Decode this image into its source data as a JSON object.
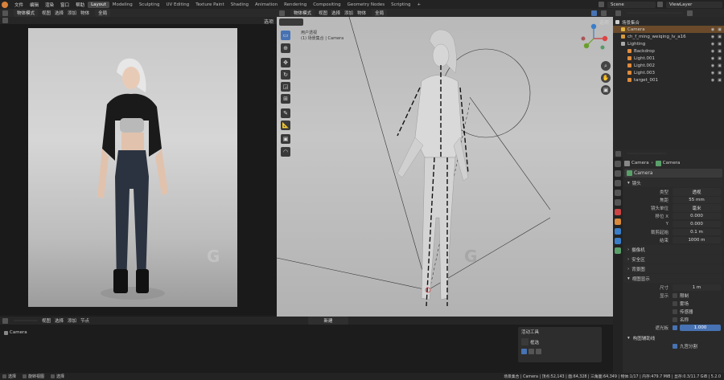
{
  "topbar": {
    "menus": [
      "文件",
      "编辑",
      "渲染",
      "窗口",
      "帮助"
    ],
    "tabs": [
      "Layout",
      "Modeling",
      "Sculpting",
      "UV Editing",
      "Texture Paint",
      "Shading",
      "Animation",
      "Rendering",
      "Compositing",
      "Geometry Nodes",
      "Scripting"
    ],
    "active_tab": "Layout",
    "scene_label": "Scene",
    "view_layer_label": "ViewLayer"
  },
  "left_viewport": {
    "mode": "物体模式",
    "menu": [
      "视图",
      "选择",
      "添加",
      "物体"
    ],
    "shading": "全局",
    "option": "选项"
  },
  "main_viewport": {
    "mode": "物体模式",
    "menu": [
      "视图",
      "选择",
      "添加",
      "物体"
    ],
    "shading": "全局",
    "option": "选项",
    "overlay_line1": "用户透视",
    "overlay_line2": "(1) 场景集合 | Camera"
  },
  "watermarks": [
    "G",
    "G",
    "G"
  ],
  "outliner": {
    "title": "场景集合",
    "items": [
      {
        "label": "Camera",
        "color": "#e0b240",
        "indent": 10,
        "selected": true
      },
      {
        "label": "ch_f_ming_weiqing_lv_a16",
        "color": "#d69a3e",
        "indent": 10
      },
      {
        "label": "Lighting",
        "color": "#aaaaaa",
        "indent": 10
      },
      {
        "label": "Backdrop",
        "color": "#e28d3f",
        "indent": 18
      },
      {
        "label": "Light.001",
        "color": "#e08a3a",
        "indent": 18
      },
      {
        "label": "Light.002",
        "color": "#e08a3a",
        "indent": 18
      },
      {
        "label": "Light.003",
        "color": "#e08a3a",
        "indent": 18
      },
      {
        "label": "target_001",
        "color": "#e08a3a",
        "indent": 18
      }
    ]
  },
  "properties": {
    "breadcrumb": [
      "Camera",
      "Camera"
    ],
    "name": "Camera",
    "lens_section": "镜头",
    "fields": [
      {
        "label": "类型",
        "value": "透视"
      },
      {
        "label": "焦距",
        "value": "55 mm"
      },
      {
        "label": "镜头单位",
        "value": "毫米"
      },
      {
        "label": "移位 X",
        "value": "0.000"
      },
      {
        "label": "Y",
        "value": "0.000"
      },
      {
        "label": "裁剪起始",
        "value": "0.1 m"
      },
      {
        "label": "结束",
        "value": "1000 m"
      }
    ],
    "sections": [
      "摄像机",
      "安全区",
      "背景图",
      "视图显示"
    ],
    "display": {
      "size_label": "尺寸",
      "size_value": "1 m",
      "show_label": "显示",
      "checks": [
        "限制",
        "雾场",
        "传感器",
        "名称"
      ],
      "passepartout_label": "遮光板",
      "passepartout_value": "1.000",
      "composition": "构图辅助线",
      "composition_item": "九宫分割"
    }
  },
  "timeline": {
    "menu": [
      "视图",
      "选择",
      "添加",
      "节点"
    ],
    "camera": "Camera",
    "selector": "新建"
  },
  "active_tool": {
    "title": "活动工具",
    "tool": "框选"
  },
  "statusbar": {
    "left": [
      "选择",
      "旋转视图",
      "选择"
    ],
    "right": "场景集合 | Camera | 顶点:52,143 | 面:64,328 | 三角面:64,349 | 物体:1/17 | 内存:479.7 MiB | 显存:0.3/11.7 GiB | 5.2.0"
  },
  "colors": {
    "accent": "#4772b3",
    "selected_row": "#e8913a",
    "bg": "#1d1d1d",
    "panel": "#2a2a2a"
  }
}
